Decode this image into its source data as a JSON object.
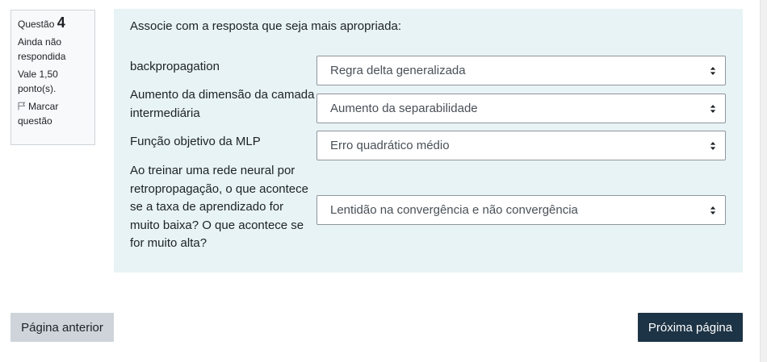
{
  "question_info": {
    "label": "Questão",
    "number": "4",
    "status_line1": "Ainda não",
    "status_line2": "respondida",
    "points_line1": "Vale 1,50",
    "points_line2": "ponto(s).",
    "flag_line1": "Marcar",
    "flag_line2": "questão"
  },
  "question": {
    "prompt": "Associe com a resposta que seja mais apropriada:",
    "rows": [
      {
        "label": "backpropagation",
        "selected": "Regra delta generalizada"
      },
      {
        "label": "Aumento da dimensão da camada intermediária",
        "selected": "Aumento da separabilidade"
      },
      {
        "label": "Função objetivo da MLP",
        "selected": "Erro quadrático médio"
      },
      {
        "label": "Ao treinar uma rede neural por retropropagação, o que acontece se a taxa de aprendizado for muito baixa? O que acontece se for muito alta?",
        "selected": "Lentidão na convergência e não convergência"
      }
    ]
  },
  "navigation": {
    "prev_label": "Página anterior",
    "next_label": "Próxima página"
  },
  "colors": {
    "content_bg": "#e7f3f5",
    "next_button_bg": "#1d3446",
    "prev_button_bg": "#ced4da"
  }
}
